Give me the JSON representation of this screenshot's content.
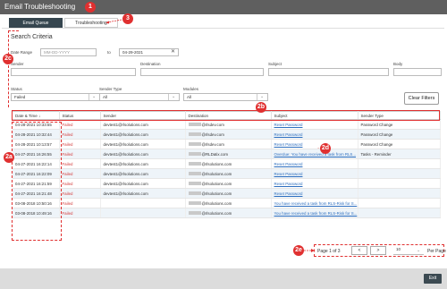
{
  "window": {
    "title": "Email Troubleshooting"
  },
  "tabs": [
    {
      "label": "Email Queue",
      "active": true
    },
    {
      "label": "Troubleshooting",
      "active": false
    }
  ],
  "search": {
    "title": "Search Criteria",
    "date_range_label": "Date Range",
    "date_from_placeholder": "MM-DD-YYYY",
    "to_label": "to",
    "date_to_value": "04-29-2021",
    "sender_label": "Sender",
    "destination_label": "Destination",
    "subject_label": "Subject",
    "body_label": "Body",
    "status_label": "Status",
    "status_value": "Failed",
    "sender_type_label": "Sender Type",
    "sender_type_value": "All",
    "modules_label": "Modules",
    "modules_value": "All",
    "clear_filters_label": "Clear Filters"
  },
  "table": {
    "columns": [
      "Date & Time",
      "Status",
      "Sender",
      "Destination",
      "Subject",
      "Sender Type"
    ],
    "rows": [
      {
        "datetime": "04-28-2021 10:33:55",
        "status": "Failed",
        "sender": "devtest1@rlsolutions.com",
        "destination": "@rlsdev.com",
        "subject": "Reset Password",
        "sender_type": "Password Change"
      },
      {
        "datetime": "04-28-2021 10:32:44",
        "status": "Failed",
        "sender": "devtest1@rlsolutions.com",
        "destination": "@rlsdev.com",
        "subject": "Reset Password",
        "sender_type": "Password Change"
      },
      {
        "datetime": "04-28-2021 10:13:57",
        "status": "Failed",
        "sender": "devtest1@rlsolutions.com",
        "destination": "@rlsdev.com",
        "subject": "Reset Password",
        "sender_type": "Password Change"
      },
      {
        "datetime": "04-27-2021 16:26:55",
        "status": "Failed",
        "sender": "devtest1@rlsolutions.com",
        "destination": "@RLDatix.com",
        "subject": "Overdue: You have received a task from RLS...",
        "sender_type": "Tasks - Reminder"
      },
      {
        "datetime": "04-27-2021 16:22:14",
        "status": "Failed",
        "sender": "devtest1@rlsolutions.com",
        "destination": "@rlsolutions.com",
        "subject": "Reset Password",
        "sender_type": ""
      },
      {
        "datetime": "04-27-2021 16:22:09",
        "status": "Failed",
        "sender": "devtest1@rlsolutions.com",
        "destination": "@rlsolutions.com",
        "subject": "Reset Password",
        "sender_type": ""
      },
      {
        "datetime": "04-27-2021 16:21:59",
        "status": "Failed",
        "sender": "devtest1@rlsolutions.com",
        "destination": "@rlsolutions.com",
        "subject": "Reset Password",
        "sender_type": ""
      },
      {
        "datetime": "04-27-2021 16:21:48",
        "status": "Failed",
        "sender": "devtest1@rlsolutions.com",
        "destination": "@rlsolutions.com",
        "subject": "Reset Password",
        "sender_type": ""
      },
      {
        "datetime": "03-08-2018 10:50:16",
        "status": "Failed",
        "sender": "",
        "destination": "@rlsolutions.com",
        "subject": "You have received a task from RLS-Risk for S...",
        "sender_type": ""
      },
      {
        "datetime": "03-08-2018 10:49:16",
        "status": "Failed",
        "sender": "",
        "destination": "@rlsolutions.com",
        "subject": "You have received a task from RLS-Risk for S...",
        "sender_type": ""
      }
    ]
  },
  "pager": {
    "info": "Page 1 of 3",
    "prev": "<",
    "next": ">",
    "page_size": "10",
    "per_page_label": "Per Page"
  },
  "footer": {
    "exit_label": "Exit"
  },
  "annotations": {
    "b1": "1",
    "b2a": "2a",
    "b2b": "2b",
    "b2c": "2c",
    "b2d": "2d",
    "b2e": "2e",
    "b3": "3"
  },
  "colors": {
    "annotation": "#e03030",
    "failed": "#d23a3a",
    "link": "#2e6fbf",
    "active_tab": "#36464f"
  }
}
